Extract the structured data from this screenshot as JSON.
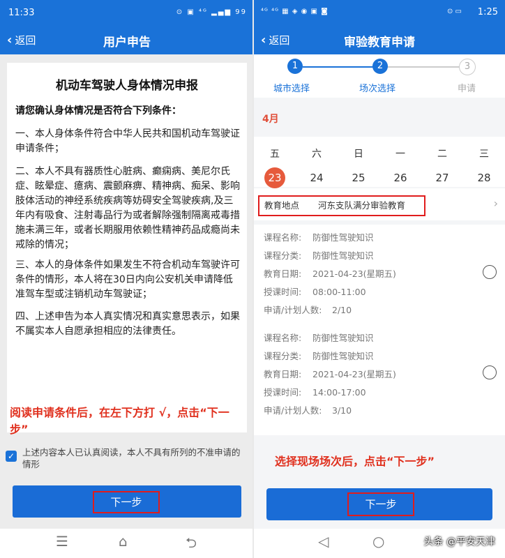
{
  "left": {
    "status_time": "11:33",
    "status_icons": "⊙ ▣ ⁴ᴳ ▂▄▆ 99",
    "back_label": "返回",
    "title": "用户申告",
    "doc_title": "机动车驾驶人身体情况申报",
    "doc_question": "请您确认身体情况是否符合下列条件：",
    "paragraphs": [
      "一、本人身体条件符合中华人民共和国机动车驾驶证申请条件；",
      "二、本人不具有器质性心脏病、癫痫病、美尼尔氏症、眩晕症、癔病、震颤麻痹、精神病、痴呆、影响肢体活动的神经系统疾病等妨碍安全驾驶疾病,及三年内有吸食、注射毒品行为或者解除强制隔离戒毒措施未满三年，或者长期服用依赖性精神药品成瘾尚未戒除的情况；",
      "三、本人的身体条件如果发生不符合机动车驾驶许可条件的情形，本人将在30日内向公安机关申请降低准驾车型或注销机动车驾驶证；",
      "四、上述申告为本人真实情况和真实意思表示，如果不属实本人自愿承担相应的法律责任。"
    ],
    "note": "阅读申请条件后，在左下方打 √，点击“下一步”",
    "agree_text": "上述内容本人已认真阅读，本人不具有所列的不准申请的情形",
    "agree_checked": true,
    "next_label": "下一步",
    "accent": "#1a72d8"
  },
  "right": {
    "status_time": "1:25",
    "status_icons_left": "⁴ᴳ ⁴ᴳ ▦ ◈ ◉ ▣ ◙",
    "status_icons_right": "⊙ ▭",
    "back_label": "返回",
    "title": "审验教育申请",
    "steps": [
      {
        "num": "1",
        "label": "城市选择",
        "state": "done"
      },
      {
        "num": "2",
        "label": "场次选择",
        "state": "active"
      },
      {
        "num": "3",
        "label": "申请",
        "state": "todo"
      }
    ],
    "month": "4月",
    "weekdays": [
      "五",
      "六",
      "日",
      "一",
      "二",
      "三"
    ],
    "dates": [
      "23",
      "24",
      "25",
      "26",
      "27",
      "28"
    ],
    "selected_date": "23",
    "place_label": "教育地点",
    "place_value": "河东支队满分审验教育",
    "sessions": [
      {
        "course_name_k": "课程名称:",
        "course_name": "防御性驾驶知识",
        "course_type_k": "课程分类:",
        "course_type": "防御性驾驶知识",
        "date_k": "教育日期:",
        "date": "2021-04-23(星期五)",
        "time_k": "授课时间:",
        "time": "08:00-11:00",
        "count_k": "申请/计划人数:",
        "count": "2/10"
      },
      {
        "course_name_k": "课程名称:",
        "course_name": "防御性驾驶知识",
        "course_type_k": "课程分类:",
        "course_type": "防御性驾驶知识",
        "date_k": "教育日期:",
        "date": "2021-04-23(星期五)",
        "time_k": "授课时间:",
        "time": "14:00-17:00",
        "count_k": "申请/计划人数:",
        "count": "3/10"
      }
    ],
    "note": "选择现场场次后，点击“下一步”",
    "next_label": "下一步",
    "watermark": "头条 @平安天津",
    "accent": "#1a72d8",
    "highlight": "#e01c1c",
    "selected_color": "#e65a3c"
  }
}
